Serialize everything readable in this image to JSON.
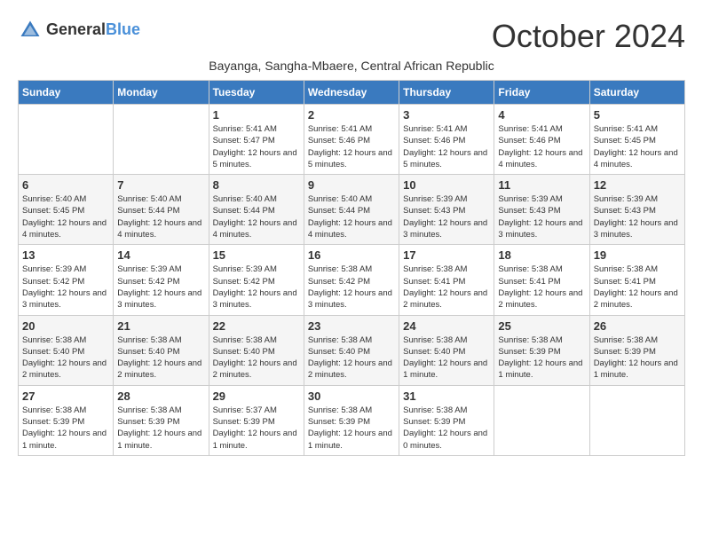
{
  "logo": {
    "general": "General",
    "blue": "Blue"
  },
  "header": {
    "month_year": "October 2024",
    "location": "Bayanga, Sangha-Mbaere, Central African Republic"
  },
  "weekdays": [
    "Sunday",
    "Monday",
    "Tuesday",
    "Wednesday",
    "Thursday",
    "Friday",
    "Saturday"
  ],
  "weeks": [
    [
      {
        "day": "",
        "sunrise": "",
        "sunset": "",
        "daylight": ""
      },
      {
        "day": "",
        "sunrise": "",
        "sunset": "",
        "daylight": ""
      },
      {
        "day": "1",
        "sunrise": "Sunrise: 5:41 AM",
        "sunset": "Sunset: 5:47 PM",
        "daylight": "Daylight: 12 hours and 5 minutes."
      },
      {
        "day": "2",
        "sunrise": "Sunrise: 5:41 AM",
        "sunset": "Sunset: 5:46 PM",
        "daylight": "Daylight: 12 hours and 5 minutes."
      },
      {
        "day": "3",
        "sunrise": "Sunrise: 5:41 AM",
        "sunset": "Sunset: 5:46 PM",
        "daylight": "Daylight: 12 hours and 5 minutes."
      },
      {
        "day": "4",
        "sunrise": "Sunrise: 5:41 AM",
        "sunset": "Sunset: 5:46 PM",
        "daylight": "Daylight: 12 hours and 4 minutes."
      },
      {
        "day": "5",
        "sunrise": "Sunrise: 5:41 AM",
        "sunset": "Sunset: 5:45 PM",
        "daylight": "Daylight: 12 hours and 4 minutes."
      }
    ],
    [
      {
        "day": "6",
        "sunrise": "Sunrise: 5:40 AM",
        "sunset": "Sunset: 5:45 PM",
        "daylight": "Daylight: 12 hours and 4 minutes."
      },
      {
        "day": "7",
        "sunrise": "Sunrise: 5:40 AM",
        "sunset": "Sunset: 5:44 PM",
        "daylight": "Daylight: 12 hours and 4 minutes."
      },
      {
        "day": "8",
        "sunrise": "Sunrise: 5:40 AM",
        "sunset": "Sunset: 5:44 PM",
        "daylight": "Daylight: 12 hours and 4 minutes."
      },
      {
        "day": "9",
        "sunrise": "Sunrise: 5:40 AM",
        "sunset": "Sunset: 5:44 PM",
        "daylight": "Daylight: 12 hours and 4 minutes."
      },
      {
        "day": "10",
        "sunrise": "Sunrise: 5:39 AM",
        "sunset": "Sunset: 5:43 PM",
        "daylight": "Daylight: 12 hours and 3 minutes."
      },
      {
        "day": "11",
        "sunrise": "Sunrise: 5:39 AM",
        "sunset": "Sunset: 5:43 PM",
        "daylight": "Daylight: 12 hours and 3 minutes."
      },
      {
        "day": "12",
        "sunrise": "Sunrise: 5:39 AM",
        "sunset": "Sunset: 5:43 PM",
        "daylight": "Daylight: 12 hours and 3 minutes."
      }
    ],
    [
      {
        "day": "13",
        "sunrise": "Sunrise: 5:39 AM",
        "sunset": "Sunset: 5:42 PM",
        "daylight": "Daylight: 12 hours and 3 minutes."
      },
      {
        "day": "14",
        "sunrise": "Sunrise: 5:39 AM",
        "sunset": "Sunset: 5:42 PM",
        "daylight": "Daylight: 12 hours and 3 minutes."
      },
      {
        "day": "15",
        "sunrise": "Sunrise: 5:39 AM",
        "sunset": "Sunset: 5:42 PM",
        "daylight": "Daylight: 12 hours and 3 minutes."
      },
      {
        "day": "16",
        "sunrise": "Sunrise: 5:38 AM",
        "sunset": "Sunset: 5:42 PM",
        "daylight": "Daylight: 12 hours and 3 minutes."
      },
      {
        "day": "17",
        "sunrise": "Sunrise: 5:38 AM",
        "sunset": "Sunset: 5:41 PM",
        "daylight": "Daylight: 12 hours and 2 minutes."
      },
      {
        "day": "18",
        "sunrise": "Sunrise: 5:38 AM",
        "sunset": "Sunset: 5:41 PM",
        "daylight": "Daylight: 12 hours and 2 minutes."
      },
      {
        "day": "19",
        "sunrise": "Sunrise: 5:38 AM",
        "sunset": "Sunset: 5:41 PM",
        "daylight": "Daylight: 12 hours and 2 minutes."
      }
    ],
    [
      {
        "day": "20",
        "sunrise": "Sunrise: 5:38 AM",
        "sunset": "Sunset: 5:40 PM",
        "daylight": "Daylight: 12 hours and 2 minutes."
      },
      {
        "day": "21",
        "sunrise": "Sunrise: 5:38 AM",
        "sunset": "Sunset: 5:40 PM",
        "daylight": "Daylight: 12 hours and 2 minutes."
      },
      {
        "day": "22",
        "sunrise": "Sunrise: 5:38 AM",
        "sunset": "Sunset: 5:40 PM",
        "daylight": "Daylight: 12 hours and 2 minutes."
      },
      {
        "day": "23",
        "sunrise": "Sunrise: 5:38 AM",
        "sunset": "Sunset: 5:40 PM",
        "daylight": "Daylight: 12 hours and 2 minutes."
      },
      {
        "day": "24",
        "sunrise": "Sunrise: 5:38 AM",
        "sunset": "Sunset: 5:40 PM",
        "daylight": "Daylight: 12 hours and 1 minute."
      },
      {
        "day": "25",
        "sunrise": "Sunrise: 5:38 AM",
        "sunset": "Sunset: 5:39 PM",
        "daylight": "Daylight: 12 hours and 1 minute."
      },
      {
        "day": "26",
        "sunrise": "Sunrise: 5:38 AM",
        "sunset": "Sunset: 5:39 PM",
        "daylight": "Daylight: 12 hours and 1 minute."
      }
    ],
    [
      {
        "day": "27",
        "sunrise": "Sunrise: 5:38 AM",
        "sunset": "Sunset: 5:39 PM",
        "daylight": "Daylight: 12 hours and 1 minute."
      },
      {
        "day": "28",
        "sunrise": "Sunrise: 5:38 AM",
        "sunset": "Sunset: 5:39 PM",
        "daylight": "Daylight: 12 hours and 1 minute."
      },
      {
        "day": "29",
        "sunrise": "Sunrise: 5:37 AM",
        "sunset": "Sunset: 5:39 PM",
        "daylight": "Daylight: 12 hours and 1 minute."
      },
      {
        "day": "30",
        "sunrise": "Sunrise: 5:38 AM",
        "sunset": "Sunset: 5:39 PM",
        "daylight": "Daylight: 12 hours and 1 minute."
      },
      {
        "day": "31",
        "sunrise": "Sunrise: 5:38 AM",
        "sunset": "Sunset: 5:39 PM",
        "daylight": "Daylight: 12 hours and 0 minutes."
      },
      {
        "day": "",
        "sunrise": "",
        "sunset": "",
        "daylight": ""
      },
      {
        "day": "",
        "sunrise": "",
        "sunset": "",
        "daylight": ""
      }
    ]
  ]
}
